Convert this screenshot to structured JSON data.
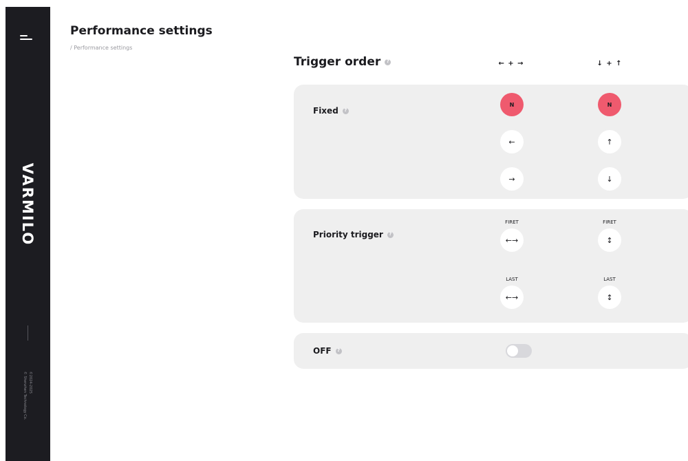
{
  "sidebar": {
    "brand": "VARMILO",
    "copyright_line1": "©2024-2025",
    "copyright_line2": "© Shenzhen Technology Co."
  },
  "header": {
    "title": "Performance settings",
    "breadcrumb": "/ Performance settings"
  },
  "trigger_order": {
    "title": "Trigger order",
    "columns": [
      {
        "label": "← + →"
      },
      {
        "label": "↓ + ↑"
      }
    ]
  },
  "fixed": {
    "label": "Fixed",
    "col1": [
      "N",
      "←",
      "→"
    ],
    "col2": [
      "N",
      "↑",
      "↓"
    ],
    "selected_col1": "N",
    "selected_col2": "N"
  },
  "priority": {
    "label": "Priority trigger",
    "first_label": "FIRET",
    "last_label": "LAST",
    "col1_first": "←→",
    "col1_last": "←→",
    "col2_first": "↕",
    "col2_last": "↕"
  },
  "off": {
    "label": "OFF",
    "enabled": false
  },
  "colors": {
    "sidebar_bg": "#1c1c21",
    "panel_bg": "#efefef",
    "accent": "#ef5a6e"
  }
}
